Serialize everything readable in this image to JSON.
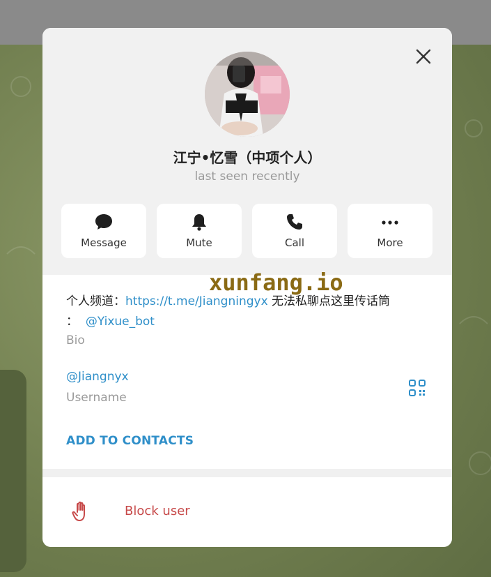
{
  "profile": {
    "name": "江宁•忆雪（中项个人）",
    "status": "last seen recently"
  },
  "actions": [
    {
      "label": "Message",
      "icon": "chat-bubble-icon"
    },
    {
      "label": "Mute",
      "icon": "bell-icon"
    },
    {
      "label": "Call",
      "icon": "phone-icon"
    },
    {
      "label": "More",
      "icon": "more-dots-icon"
    }
  ],
  "bio": {
    "prefix": "个人频道：",
    "channel_link": "https://t.me/Jiangningyx",
    "middle": " 无法私聊点这里传话筒",
    "colon": "：",
    "bot_link": "@Yixue_bot",
    "label": "Bio"
  },
  "username": {
    "value": "@Jiangnyx",
    "label": "Username"
  },
  "add_contacts_label": "ADD TO CONTACTS",
  "block_label": "Block user",
  "watermark": "xunfang.io",
  "colors": {
    "accent": "#2f8fc9",
    "danger": "#c74a4a",
    "header_bg": "#f1f1f1"
  }
}
